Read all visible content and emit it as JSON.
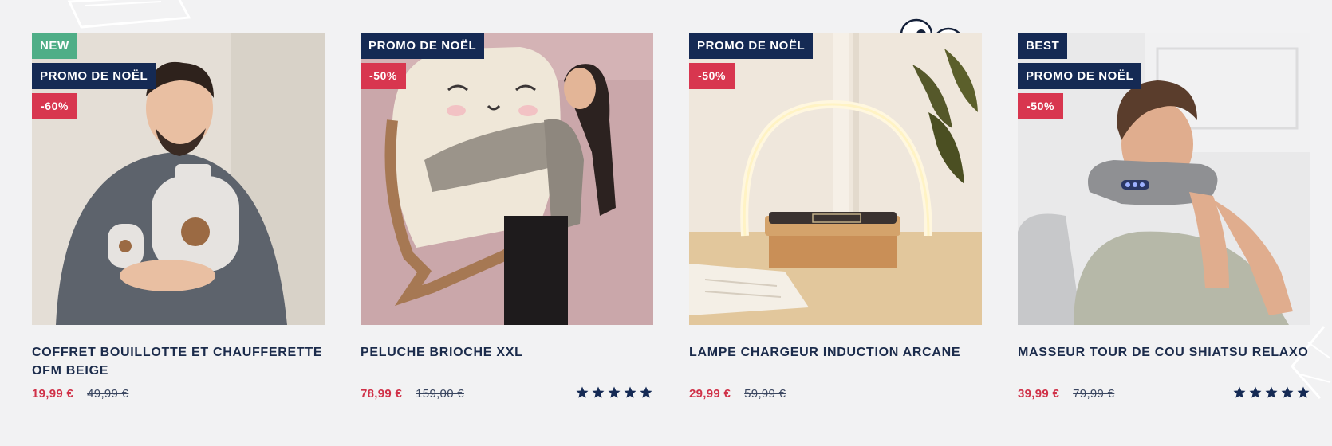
{
  "colors": {
    "background": "#f2f2f3",
    "badge_new": "#4fae87",
    "badge_navy": "#152a54",
    "badge_discount": "#d8364f",
    "price_sale": "#d03148",
    "title": "#1b2b4b"
  },
  "products": [
    {
      "badges": {
        "new": "NEW",
        "promo": "PROMO DE NOËL",
        "discount": "-60%"
      },
      "title": "COFFRET BOUILLOTTE ET CHAUFFERETTE OFM BEIGE",
      "price": "19,99 €",
      "old_price": "49,99 €",
      "rating": null
    },
    {
      "badges": {
        "promo": "PROMO DE NOËL",
        "discount": "-50%"
      },
      "title": "PELUCHE BRIOCHE XXL",
      "price": "78,99 €",
      "old_price": "159,00 €",
      "rating": 5
    },
    {
      "badges": {
        "promo": "PROMO DE NOËL",
        "discount": "-50%"
      },
      "title": "LAMPE CHARGEUR INDUCTION ARCANE",
      "price": "29,99 €",
      "old_price": "59,99 €",
      "rating": null
    },
    {
      "badges": {
        "best": "BEST",
        "promo": "PROMO DE NOËL",
        "discount": "-50%"
      },
      "title": "MASSEUR TOUR DE COU SHIATSU RELAXO",
      "price": "39,99 €",
      "old_price": "79,99 €",
      "rating": 5
    }
  ]
}
